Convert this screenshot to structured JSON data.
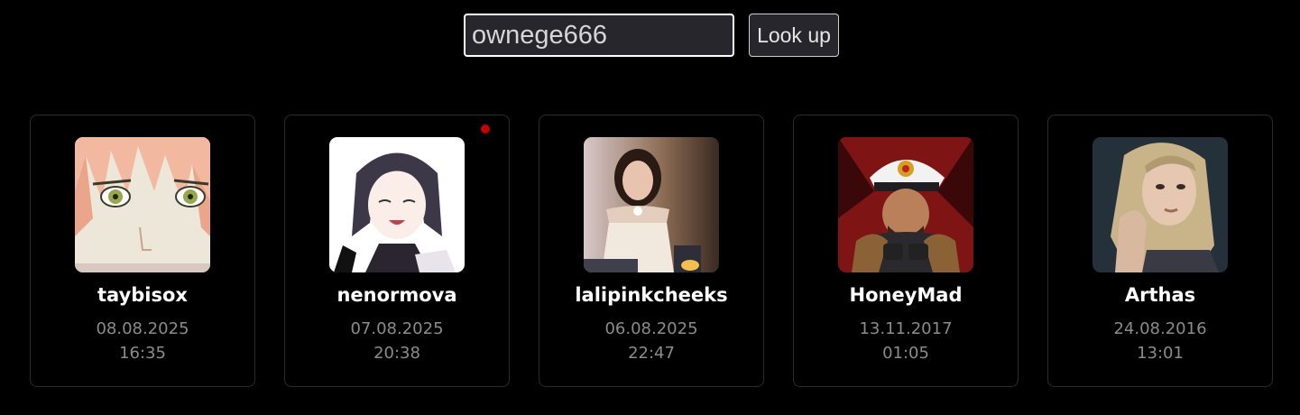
{
  "search": {
    "value": "ownege666",
    "button_label": "Look up"
  },
  "colors": {
    "background": "#000000",
    "input_background": "#27262d",
    "live_indicator": "#c70000",
    "date_text": "#8b8b8b"
  },
  "cards": [
    {
      "username": "taybisox",
      "date": "08.08.2025",
      "time": "16:35",
      "live": false,
      "avatar": "anime-pink-hair-green-eyes"
    },
    {
      "username": "nenormova",
      "date": "07.08.2025",
      "time": "20:38",
      "live": true,
      "avatar": "anime-dark-hair-girl"
    },
    {
      "username": "lalipinkcheeks",
      "date": "06.08.2025",
      "time": "22:47",
      "live": false,
      "avatar": "photo-girl-white-top"
    },
    {
      "username": "HoneyMad",
      "date": "13.11.2017",
      "time": "01:05",
      "live": false,
      "avatar": "captain-illustration"
    },
    {
      "username": "Arthas",
      "date": "24.08.2016",
      "time": "13:01",
      "live": false,
      "avatar": "photo-blonde-woman"
    }
  ]
}
